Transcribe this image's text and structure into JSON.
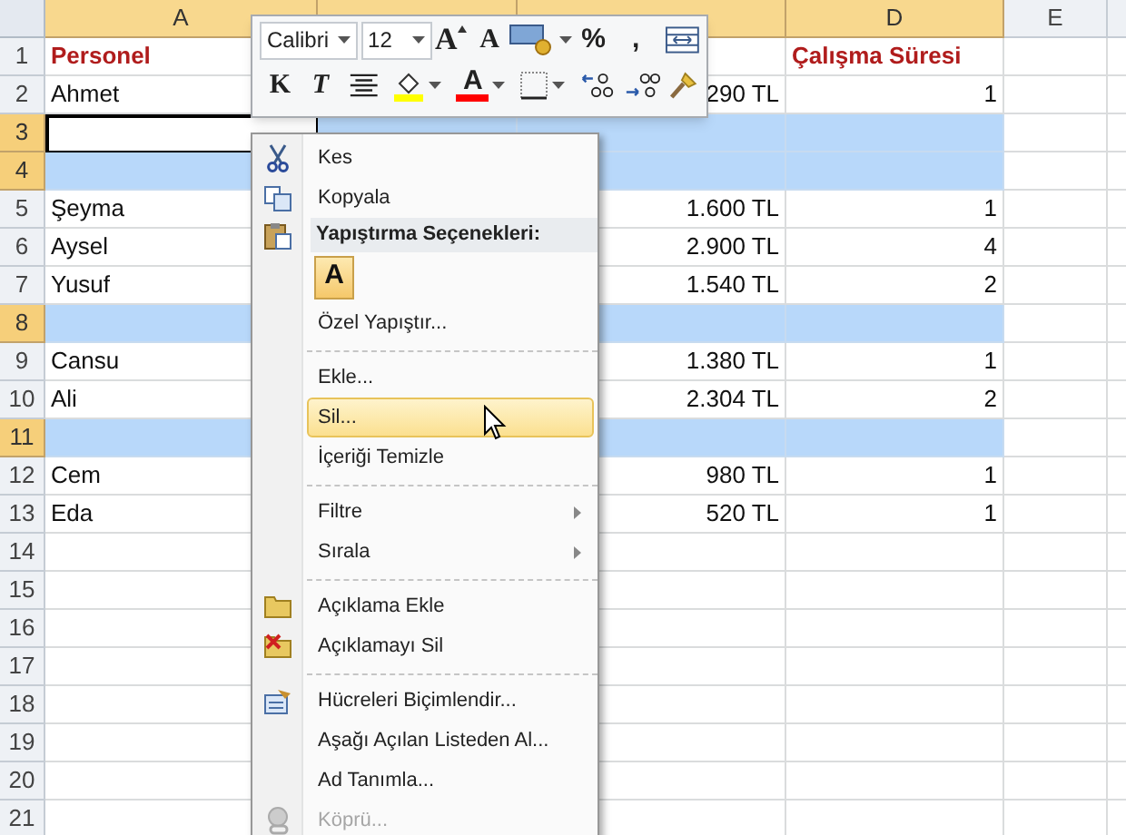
{
  "columns": [
    {
      "label": "A",
      "selected": true
    },
    {
      "selected": true
    },
    {
      "selected": true
    },
    {
      "label": "D",
      "selected": true
    },
    {
      "label": "E",
      "selected": false
    }
  ],
  "rows": [
    {
      "number": "1",
      "selected": false,
      "kind": "heading",
      "cells": {
        "a": "Personel",
        "d": "Çalışma Süresi"
      }
    },
    {
      "number": "2",
      "selected": false,
      "kind": "data",
      "cells": {
        "a": "Ahmet",
        "c": "290 TL",
        "d": "1"
      }
    },
    {
      "number": "3",
      "selected": true,
      "active": true,
      "kind": "data",
      "cells": {}
    },
    {
      "number": "4",
      "selected": true,
      "active": false,
      "kind": "data",
      "cells": {}
    },
    {
      "number": "5",
      "selected": false,
      "kind": "data",
      "cells": {
        "a": "Şeyma",
        "c": "1.600 TL",
        "d": "1"
      }
    },
    {
      "number": "6",
      "selected": false,
      "kind": "data",
      "cells": {
        "a": "Aysel",
        "c": "2.900 TL",
        "d": "4"
      }
    },
    {
      "number": "7",
      "selected": false,
      "kind": "data",
      "cells": {
        "a": "Yusuf",
        "c": "1.540 TL",
        "d": "2"
      }
    },
    {
      "number": "8",
      "selected": true,
      "active": false,
      "kind": "data",
      "cells": {}
    },
    {
      "number": "9",
      "selected": false,
      "kind": "data",
      "cells": {
        "a": "Cansu",
        "c": "1.380 TL",
        "d": "1"
      }
    },
    {
      "number": "10",
      "selected": false,
      "kind": "data",
      "cells": {
        "a": "Ali",
        "c": "2.304 TL",
        "d": "2"
      }
    },
    {
      "number": "11",
      "selected": true,
      "active": false,
      "kind": "data",
      "cells": {}
    },
    {
      "number": "12",
      "selected": false,
      "kind": "data",
      "cells": {
        "a": "Cem",
        "c": "980 TL",
        "d": "1"
      }
    },
    {
      "number": "13",
      "selected": false,
      "kind": "data",
      "cells": {
        "a": "Eda",
        "c": "520 TL",
        "d": "1"
      }
    },
    {
      "number": "14",
      "selected": false,
      "kind": "data",
      "cells": {}
    },
    {
      "number": "15",
      "selected": false,
      "kind": "data",
      "cells": {}
    },
    {
      "number": "16",
      "selected": false,
      "kind": "data",
      "cells": {}
    },
    {
      "number": "17",
      "selected": false,
      "kind": "data",
      "cells": {}
    },
    {
      "number": "18",
      "selected": false,
      "kind": "data",
      "cells": {}
    },
    {
      "number": "19",
      "selected": false,
      "kind": "data",
      "cells": {}
    },
    {
      "number": "20",
      "selected": false,
      "kind": "data",
      "cells": {}
    },
    {
      "number": "21",
      "selected": false,
      "kind": "data",
      "cells": {}
    }
  ],
  "mini_toolbar": {
    "font": "Calibri",
    "size": "12",
    "row_1": [
      {
        "kind": "grow",
        "label": "A"
      },
      {
        "kind": "shrink",
        "label": "A"
      },
      {
        "kind": "format"
      },
      {
        "kind": "text",
        "label": "%"
      },
      {
        "kind": "text",
        "label": ","
      },
      {
        "kind": "merge"
      }
    ],
    "row_2": [
      {
        "kind": "bold",
        "label": "K"
      },
      {
        "kind": "italic",
        "label": "T"
      },
      {
        "kind": "center"
      },
      {
        "kind": "fill"
      },
      {
        "kind": "fontcolor",
        "label": "A"
      },
      {
        "kind": "border"
      },
      {
        "kind": "incdec"
      },
      {
        "kind": "decdec"
      },
      {
        "kind": "painter"
      }
    ]
  },
  "context_menu": [
    {
      "kind": "item",
      "label": "Kes",
      "selected": false,
      "disabled": false,
      "submenu": false
    },
    {
      "kind": "item",
      "label": "Kopyala",
      "selected": false,
      "disabled": false,
      "submenu": false
    },
    {
      "kind": "header",
      "label": "Yapıştırma Seçenekleri:"
    },
    {
      "kind": "paste",
      "label": "A"
    },
    {
      "kind": "item",
      "label": "Özel Yapıştır...",
      "selected": false,
      "disabled": false,
      "submenu": false
    },
    {
      "kind": "separator"
    },
    {
      "kind": "item",
      "label": "Ekle...",
      "selected": false,
      "disabled": false,
      "submenu": false
    },
    {
      "kind": "item",
      "label": "Sil...",
      "selected": true,
      "disabled": false,
      "submenu": false
    },
    {
      "kind": "item",
      "label": "İçeriği Temizle",
      "selected": false,
      "disabled": false,
      "submenu": false
    },
    {
      "kind": "separator"
    },
    {
      "kind": "item",
      "label": "Filtre",
      "selected": false,
      "disabled": false,
      "submenu": true
    },
    {
      "kind": "item",
      "label": "Sırala",
      "selected": false,
      "disabled": false,
      "submenu": true
    },
    {
      "kind": "separator"
    },
    {
      "kind": "item",
      "label": "Açıklama Ekle",
      "selected": false,
      "disabled": false,
      "submenu": false
    },
    {
      "kind": "item",
      "label": "Açıklamayı Sil",
      "selected": false,
      "disabled": false,
      "submenu": false
    },
    {
      "kind": "separator"
    },
    {
      "kind": "item",
      "label": "Hücreleri Biçimlendir...",
      "selected": false,
      "disabled": false,
      "submenu": false
    },
    {
      "kind": "item",
      "label": "Aşağı Açılan Listeden Al...",
      "selected": false,
      "disabled": false,
      "submenu": false
    },
    {
      "kind": "item",
      "label": "Ad Tanımla...",
      "selected": false,
      "disabled": false,
      "submenu": false
    },
    {
      "kind": "item",
      "label": "Köprü...",
      "selected": false,
      "disabled": true,
      "submenu": false
    }
  ]
}
